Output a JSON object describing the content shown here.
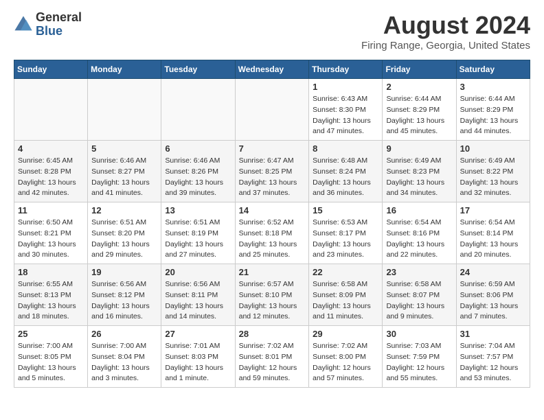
{
  "logo": {
    "general": "General",
    "blue": "Blue"
  },
  "title": "August 2024",
  "location": "Firing Range, Georgia, United States",
  "days_of_week": [
    "Sunday",
    "Monday",
    "Tuesday",
    "Wednesday",
    "Thursday",
    "Friday",
    "Saturday"
  ],
  "weeks": [
    [
      {
        "day": "",
        "info": ""
      },
      {
        "day": "",
        "info": ""
      },
      {
        "day": "",
        "info": ""
      },
      {
        "day": "",
        "info": ""
      },
      {
        "day": "1",
        "sunrise": "Sunrise: 6:43 AM",
        "sunset": "Sunset: 8:30 PM",
        "daylight": "Daylight: 13 hours and 47 minutes."
      },
      {
        "day": "2",
        "sunrise": "Sunrise: 6:44 AM",
        "sunset": "Sunset: 8:29 PM",
        "daylight": "Daylight: 13 hours and 45 minutes."
      },
      {
        "day": "3",
        "sunrise": "Sunrise: 6:44 AM",
        "sunset": "Sunset: 8:29 PM",
        "daylight": "Daylight: 13 hours and 44 minutes."
      }
    ],
    [
      {
        "day": "4",
        "sunrise": "Sunrise: 6:45 AM",
        "sunset": "Sunset: 8:28 PM",
        "daylight": "Daylight: 13 hours and 42 minutes."
      },
      {
        "day": "5",
        "sunrise": "Sunrise: 6:46 AM",
        "sunset": "Sunset: 8:27 PM",
        "daylight": "Daylight: 13 hours and 41 minutes."
      },
      {
        "day": "6",
        "sunrise": "Sunrise: 6:46 AM",
        "sunset": "Sunset: 8:26 PM",
        "daylight": "Daylight: 13 hours and 39 minutes."
      },
      {
        "day": "7",
        "sunrise": "Sunrise: 6:47 AM",
        "sunset": "Sunset: 8:25 PM",
        "daylight": "Daylight: 13 hours and 37 minutes."
      },
      {
        "day": "8",
        "sunrise": "Sunrise: 6:48 AM",
        "sunset": "Sunset: 8:24 PM",
        "daylight": "Daylight: 13 hours and 36 minutes."
      },
      {
        "day": "9",
        "sunrise": "Sunrise: 6:49 AM",
        "sunset": "Sunset: 8:23 PM",
        "daylight": "Daylight: 13 hours and 34 minutes."
      },
      {
        "day": "10",
        "sunrise": "Sunrise: 6:49 AM",
        "sunset": "Sunset: 8:22 PM",
        "daylight": "Daylight: 13 hours and 32 minutes."
      }
    ],
    [
      {
        "day": "11",
        "sunrise": "Sunrise: 6:50 AM",
        "sunset": "Sunset: 8:21 PM",
        "daylight": "Daylight: 13 hours and 30 minutes."
      },
      {
        "day": "12",
        "sunrise": "Sunrise: 6:51 AM",
        "sunset": "Sunset: 8:20 PM",
        "daylight": "Daylight: 13 hours and 29 minutes."
      },
      {
        "day": "13",
        "sunrise": "Sunrise: 6:51 AM",
        "sunset": "Sunset: 8:19 PM",
        "daylight": "Daylight: 13 hours and 27 minutes."
      },
      {
        "day": "14",
        "sunrise": "Sunrise: 6:52 AM",
        "sunset": "Sunset: 8:18 PM",
        "daylight": "Daylight: 13 hours and 25 minutes."
      },
      {
        "day": "15",
        "sunrise": "Sunrise: 6:53 AM",
        "sunset": "Sunset: 8:17 PM",
        "daylight": "Daylight: 13 hours and 23 minutes."
      },
      {
        "day": "16",
        "sunrise": "Sunrise: 6:54 AM",
        "sunset": "Sunset: 8:16 PM",
        "daylight": "Daylight: 13 hours and 22 minutes."
      },
      {
        "day": "17",
        "sunrise": "Sunrise: 6:54 AM",
        "sunset": "Sunset: 8:14 PM",
        "daylight": "Daylight: 13 hours and 20 minutes."
      }
    ],
    [
      {
        "day": "18",
        "sunrise": "Sunrise: 6:55 AM",
        "sunset": "Sunset: 8:13 PM",
        "daylight": "Daylight: 13 hours and 18 minutes."
      },
      {
        "day": "19",
        "sunrise": "Sunrise: 6:56 AM",
        "sunset": "Sunset: 8:12 PM",
        "daylight": "Daylight: 13 hours and 16 minutes."
      },
      {
        "day": "20",
        "sunrise": "Sunrise: 6:56 AM",
        "sunset": "Sunset: 8:11 PM",
        "daylight": "Daylight: 13 hours and 14 minutes."
      },
      {
        "day": "21",
        "sunrise": "Sunrise: 6:57 AM",
        "sunset": "Sunset: 8:10 PM",
        "daylight": "Daylight: 13 hours and 12 minutes."
      },
      {
        "day": "22",
        "sunrise": "Sunrise: 6:58 AM",
        "sunset": "Sunset: 8:09 PM",
        "daylight": "Daylight: 13 hours and 11 minutes."
      },
      {
        "day": "23",
        "sunrise": "Sunrise: 6:58 AM",
        "sunset": "Sunset: 8:07 PM",
        "daylight": "Daylight: 13 hours and 9 minutes."
      },
      {
        "day": "24",
        "sunrise": "Sunrise: 6:59 AM",
        "sunset": "Sunset: 8:06 PM",
        "daylight": "Daylight: 13 hours and 7 minutes."
      }
    ],
    [
      {
        "day": "25",
        "sunrise": "Sunrise: 7:00 AM",
        "sunset": "Sunset: 8:05 PM",
        "daylight": "Daylight: 13 hours and 5 minutes."
      },
      {
        "day": "26",
        "sunrise": "Sunrise: 7:00 AM",
        "sunset": "Sunset: 8:04 PM",
        "daylight": "Daylight: 13 hours and 3 minutes."
      },
      {
        "day": "27",
        "sunrise": "Sunrise: 7:01 AM",
        "sunset": "Sunset: 8:03 PM",
        "daylight": "Daylight: 13 hours and 1 minute."
      },
      {
        "day": "28",
        "sunrise": "Sunrise: 7:02 AM",
        "sunset": "Sunset: 8:01 PM",
        "daylight": "Daylight: 12 hours and 59 minutes."
      },
      {
        "day": "29",
        "sunrise": "Sunrise: 7:02 AM",
        "sunset": "Sunset: 8:00 PM",
        "daylight": "Daylight: 12 hours and 57 minutes."
      },
      {
        "day": "30",
        "sunrise": "Sunrise: 7:03 AM",
        "sunset": "Sunset: 7:59 PM",
        "daylight": "Daylight: 12 hours and 55 minutes."
      },
      {
        "day": "31",
        "sunrise": "Sunrise: 7:04 AM",
        "sunset": "Sunset: 7:57 PM",
        "daylight": "Daylight: 12 hours and 53 minutes."
      }
    ]
  ]
}
